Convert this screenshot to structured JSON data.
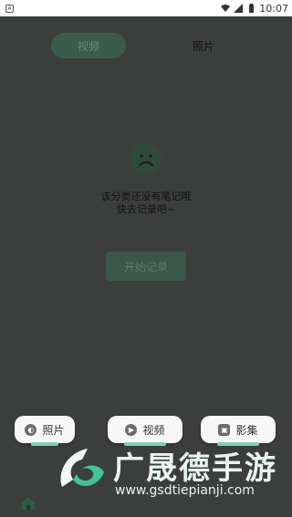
{
  "status_bar": {
    "time": "10:07",
    "left_icon": "app-badge-icon",
    "icons": [
      "wifi-icon",
      "signal-icon",
      "battery-icon"
    ]
  },
  "tabs": [
    {
      "label": "视频",
      "active": true
    },
    {
      "label": "照片",
      "active": false
    }
  ],
  "empty_state": {
    "icon": "sad-face-icon",
    "line1": "该分类还没有笔记哦",
    "line2": "快去记录吧~",
    "button_label": "开始记录"
  },
  "categories": [
    {
      "label": "照片",
      "icon": "photo-icon"
    },
    {
      "label": "视频",
      "icon": "play-icon"
    },
    {
      "label": "影集",
      "icon": "album-icon"
    }
  ],
  "bottom_nav": {
    "home_icon": "home-icon"
  },
  "watermark": {
    "name": "广晟德手游",
    "url": "www.gsdtiepianji.com"
  },
  "colors": {
    "accent": "#7fd1b6",
    "dim_overlay": "#3c3e3d",
    "button_dim": "#3a5749"
  }
}
